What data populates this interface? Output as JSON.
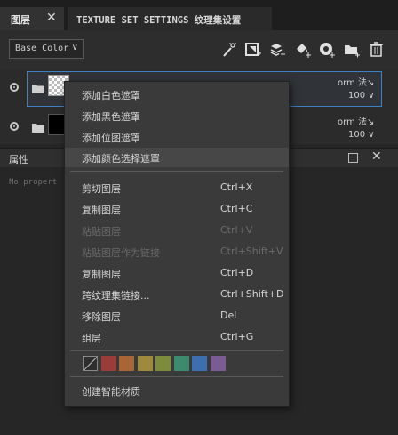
{
  "tabs": [
    {
      "label": "图层",
      "close": "✕"
    },
    {
      "label": "TEXTURE SET SETTINGS 纹理集设置"
    }
  ],
  "toolbar": {
    "channel_value": "Base Color",
    "icons": [
      "add-effect-icon",
      "add-mask-icon",
      "add-fill-layer-icon",
      "add-paint-layer-icon",
      "smart-material-icon",
      "add-folder-icon",
      "delete-icon"
    ]
  },
  "layers": [
    {
      "type": "paint",
      "blend": "orm 法↘",
      "opacity": "100 ∨"
    },
    {
      "type": "fill",
      "blend": "orm 法↘",
      "opacity": "100 ∨"
    }
  ],
  "properties": {
    "title": "属性",
    "empty": "No propert"
  },
  "context_menu": {
    "items": [
      {
        "label": "添加白色遮罩",
        "shortcut": ""
      },
      {
        "label": "添加黑色遮罩",
        "shortcut": ""
      },
      {
        "label": "添加位图遮罩",
        "shortcut": ""
      },
      {
        "label": "添加颜色选择遮罩",
        "shortcut": ""
      },
      {
        "label": "剪切图层",
        "shortcut": "Ctrl+X"
      },
      {
        "label": "复制图层",
        "shortcut": "Ctrl+C"
      },
      {
        "label": "粘贴图层",
        "shortcut": "Ctrl+V"
      },
      {
        "label": "粘贴图层作为链接",
        "shortcut": "Ctrl+Shift+V"
      },
      {
        "label": "复制图层",
        "shortcut": "Ctrl+D"
      },
      {
        "label": "跨纹理集链接...",
        "shortcut": "Ctrl+Shift+D"
      },
      {
        "label": "移除图层",
        "shortcut": "Del"
      },
      {
        "label": "组层",
        "shortcut": "Ctrl+G"
      },
      {
        "label": "创建智能材质",
        "shortcut": ""
      }
    ],
    "swatches": [
      "none",
      "#9a3d38",
      "#a86636",
      "#9d8a3c",
      "#7d8c3c",
      "#3d8a6e",
      "#3d6fb0",
      "#7b5c92"
    ]
  },
  "colors": {
    "accent": "#3f7fc4",
    "menu_bg": "#3a3a3a",
    "panel_bg": "#262626"
  }
}
